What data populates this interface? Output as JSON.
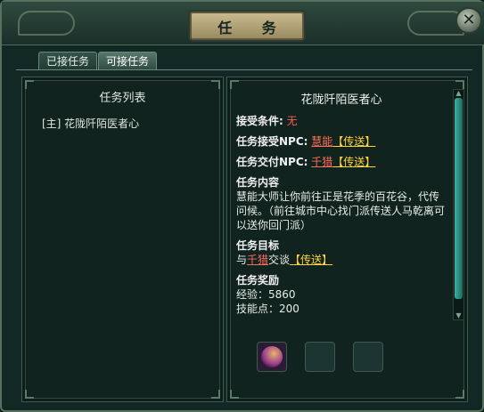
{
  "window": {
    "title": "任 务",
    "close_icon": "close-icon"
  },
  "tabs": [
    {
      "label": "已接任务"
    },
    {
      "label": "可接任务"
    }
  ],
  "list": {
    "header": "任务列表",
    "items": [
      {
        "label": "[主] 花陇阡陌医者心"
      }
    ]
  },
  "detail": {
    "title": "花陇阡陌医者心",
    "accept_condition_label": "接受条件:",
    "accept_condition_value": "无",
    "accept_npc_label": "任务接受NPC:",
    "accept_npc_name": "慧能",
    "accept_npc_teleport": "【传送】",
    "submit_npc_label": "任务交付NPC:",
    "submit_npc_name": "千猎",
    "submit_npc_teleport": "【传送】",
    "content_title": "任务内容",
    "content_text": "慧能大师让你前往正是花季的百花谷，代传问候。（前往城市中心找门派传送人马乾离可以送你回门派）",
    "target_title": "任务目标",
    "target_prefix": "与",
    "target_npc": "千猎",
    "target_suffix": "交谈",
    "target_teleport": "【传送】",
    "reward_title": "任务奖励",
    "reward_exp": "经验：5860",
    "reward_skill": "技能点：200"
  },
  "colors": {
    "accent_red": "#ff5a4a",
    "link_yellow": "#ffd23a",
    "scroll_thumb": "#3fb0a0"
  }
}
